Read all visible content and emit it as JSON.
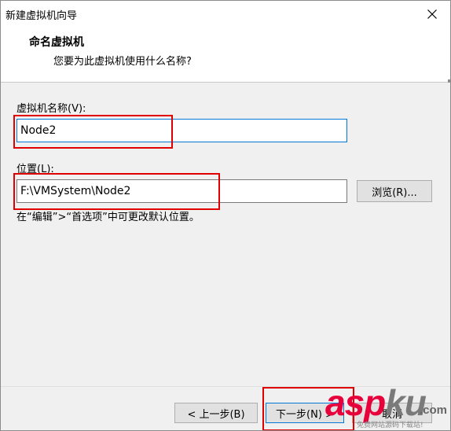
{
  "window": {
    "title": "新建虚拟机向导"
  },
  "header": {
    "title": "命名虚拟机",
    "subtitle": "您要为此虚拟机使用什么名称?"
  },
  "form": {
    "name_label": "虚拟机名称(V):",
    "name_value": "Node2",
    "location_label": "位置(L):",
    "location_value": "F:\\VMSystem\\Node2",
    "browse_label": "浏览(R)...",
    "hint": "在“编辑”>“首选项”中可更改默认位置。"
  },
  "footer": {
    "back_label": "< 上一步(B)",
    "next_label": "下一步(N) >",
    "cancel_label": "取消"
  },
  "watermark": {
    "brand_red": "asp",
    "brand_gray": "ku",
    "domain": ".com",
    "tagline": "免费网站源码下载站!"
  },
  "colors": {
    "highlight": "#e00000",
    "focus_border": "#0078d7",
    "body_bg": "#f0f0f0"
  }
}
